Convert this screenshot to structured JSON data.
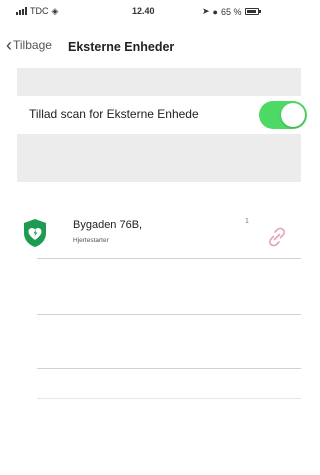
{
  "status_bar": {
    "carrier": "TDC",
    "time": "12.40",
    "battery_percent": "65 %"
  },
  "nav": {
    "back_label": "Tilbage",
    "title": "Eksterne Enheder"
  },
  "settings": {
    "scan_label": "Tillad scan for Eksterne Enhede",
    "scan_enabled": true
  },
  "devices": [
    {
      "name": "Bygaden 76B,",
      "type": "Hjertestarter",
      "count": "1"
    }
  ],
  "colors": {
    "toggle_on": "#4cd964",
    "device_icon": "#1e9b52",
    "link_icon": "#e8a0b8"
  },
  "icons": {
    "back": "chevron-left-icon",
    "device": "heart-defibrillator-icon",
    "link": "broken-link-icon"
  }
}
